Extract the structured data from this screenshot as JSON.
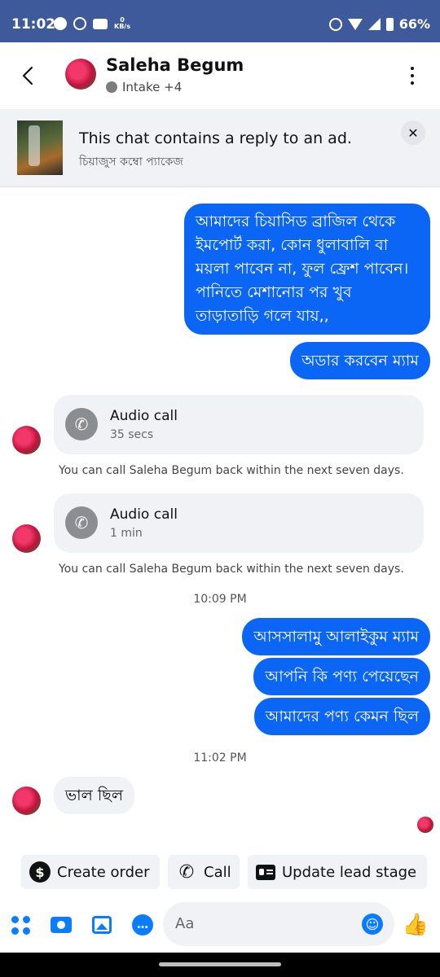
{
  "status_bar": {
    "time": "11:02",
    "net_speed": "0",
    "net_unit": "KB/s",
    "battery": "66%"
  },
  "header": {
    "name": "Saleha Begum",
    "status": "Intake +4"
  },
  "ad_banner": {
    "title": "This chat contains a reply to an ad.",
    "subtitle": "চিয়াজুস কম্বো প্যাকেজ",
    "close": "✕"
  },
  "messages": {
    "out_long": [
      "আমাদের চিয়াসিড  ব্রাজিল থেকে",
      "ইমপোর্ট করা,  কোন ধুলাবালি বা",
      "ময়লা পাবেন না, ফুল ফ্রেশ পাবেন।",
      "পানিতে মেশানোর পর  খুব",
      "তাড়াতাড়ি গলে যায়,,"
    ],
    "out_order": "অডার করবেন ম্যাম",
    "call1": {
      "title": "Audio call",
      "duration": "35 secs",
      "note": "You can call Saleha Begum back within the next seven days."
    },
    "call2": {
      "title": "Audio call",
      "duration": "1 min",
      "note": "You can call Saleha Begum back within the next seven days."
    },
    "time1": "10:09 PM",
    "out_greet": "আসসালামু আলাইকুম ম্যাম",
    "out_received": "আপনি কি পণ্য পেয়েছেন",
    "out_how": "আমাদের পণ্য কেমন ছিল",
    "time2": "11:02 PM",
    "in_reply": "ভাল ছিল"
  },
  "actions": {
    "create_order": "Create order",
    "call": "Call",
    "update_lead": "Update lead stage"
  },
  "composer": {
    "placeholder": "Aa"
  },
  "colors": {
    "status_bar": "#3f5a9a",
    "out_bubble": "#0b66f5",
    "accent": "#0a7cff",
    "in_bubble": "#f0f2f5"
  }
}
